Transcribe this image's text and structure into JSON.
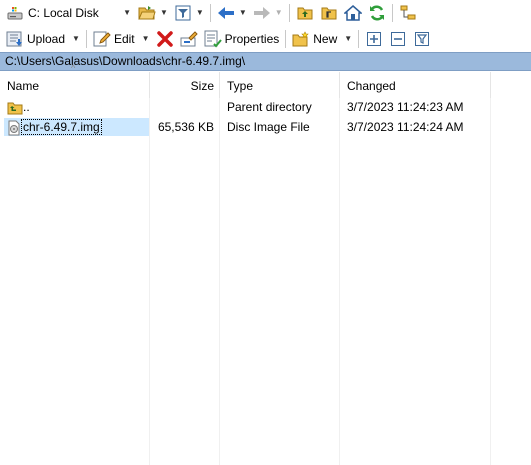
{
  "toolbar1": {
    "drive_label": "C: Local Disk"
  },
  "toolbar2": {
    "upload_label": "Upload",
    "edit_label": "Edit",
    "properties_label": "Properties",
    "new_label": "New"
  },
  "path": "C:\\Users\\Galasus\\Downloads\\chr-6.49.7.img\\",
  "columns": {
    "name": "Name",
    "size": "Size",
    "type": "Type",
    "changed": "Changed"
  },
  "files": [
    {
      "name": "..",
      "size": "",
      "type": "Parent directory",
      "changed": "3/7/2023  11:24:23 AM",
      "icon": "parent-folder-icon",
      "selected": false
    },
    {
      "name": "chr-6.49.7.img",
      "size": "65,536 KB",
      "type": "Disc Image File",
      "changed": "3/7/2023  11:24:24 AM",
      "icon": "disc-image-icon",
      "selected": true
    }
  ]
}
